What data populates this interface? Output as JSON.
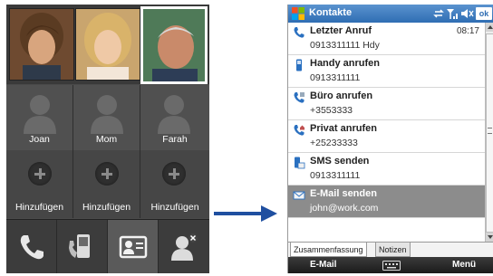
{
  "left_phone": {
    "favorites": [
      {
        "name": "Joan",
        "photo_selected": false
      },
      {
        "name": "Mom",
        "photo_selected": false
      },
      {
        "name": "Farah",
        "photo_selected": true
      }
    ],
    "add_slots": [
      {
        "label": "Hinzufügen"
      },
      {
        "label": "Hinzufügen"
      },
      {
        "label": "Hinzufügen"
      }
    ],
    "bottom_buttons": [
      {
        "icon": "phone-icon",
        "active": false
      },
      {
        "icon": "phone-contact-icon",
        "active": false
      },
      {
        "icon": "contact-card-icon",
        "active": true
      },
      {
        "icon": "contact-close-icon",
        "active": false
      }
    ]
  },
  "right_phone": {
    "title": "Kontakte",
    "ok_label": "ok",
    "entries": [
      {
        "icon": "phone-call-icon",
        "label": "Letzter Anruf",
        "value": "0913311111 Hdy",
        "time": "08:17"
      },
      {
        "icon": "mobile-phone-icon",
        "label": "Handy anrufen",
        "value": "0913311111"
      },
      {
        "icon": "office-phone-icon",
        "label": "Büro anrufen",
        "value": "+3553333"
      },
      {
        "icon": "home-phone-icon",
        "label": "Privat anrufen",
        "value": "+25233333"
      },
      {
        "icon": "sms-icon",
        "label": "SMS senden",
        "value": "0913311111"
      },
      {
        "icon": "email-icon",
        "label": "E-Mail senden",
        "value": "john@work.com",
        "selected": true
      }
    ],
    "tabs": [
      "Zusammenfassung",
      "Notizen"
    ],
    "softkeys": {
      "left": "E-Mail",
      "right": "Menü"
    }
  },
  "colors": {
    "title_bar": "#2f6db3",
    "selected_row": "#8c8c8c",
    "arrow": "#1f4fa0"
  }
}
